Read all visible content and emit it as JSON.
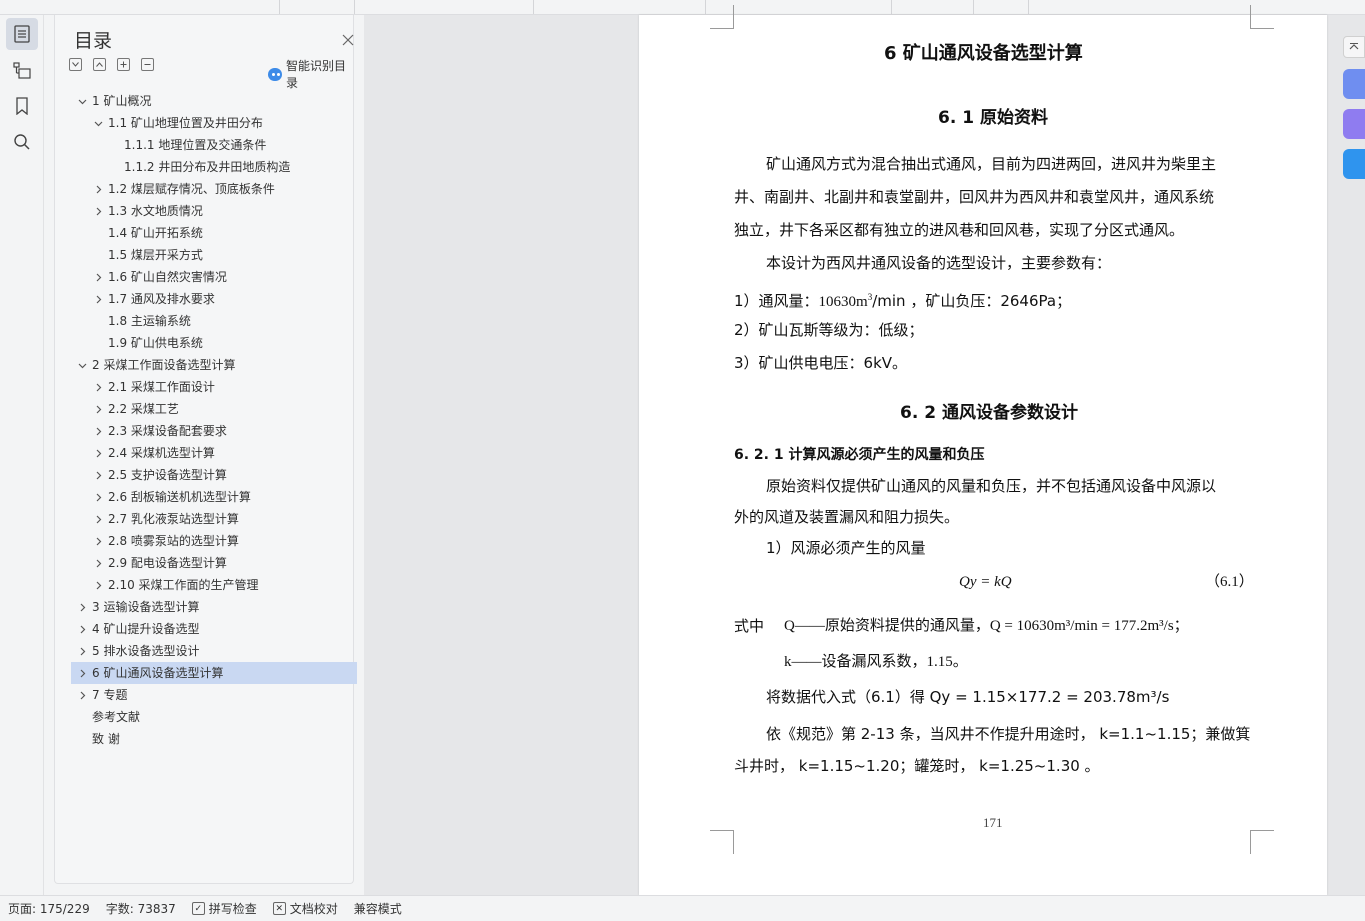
{
  "toc": {
    "title": "目录",
    "smart_label": "智能识别目录",
    "items": [
      {
        "label": "1 矿山概况",
        "level": 0,
        "chevron": "down"
      },
      {
        "label": "1.1 矿山地理位置及井田分布",
        "level": 1,
        "chevron": "down"
      },
      {
        "label": "1.1.1 地理位置及交通条件",
        "level": 2,
        "chevron": "none"
      },
      {
        "label": "1.1.2 井田分布及井田地质构造",
        "level": 2,
        "chevron": "none"
      },
      {
        "label": "1.2 煤层赋存情况、顶底板条件",
        "level": 1,
        "chevron": "right"
      },
      {
        "label": "1.3 水文地质情况",
        "level": 1,
        "chevron": "right"
      },
      {
        "label": "1.4 矿山开拓系统",
        "level": 1,
        "chevron": "none"
      },
      {
        "label": "1.5 煤层开采方式",
        "level": 1,
        "chevron": "none"
      },
      {
        "label": "1.6 矿山自然灾害情况",
        "level": 1,
        "chevron": "right"
      },
      {
        "label": "1.7 通风及排水要求",
        "level": 1,
        "chevron": "right"
      },
      {
        "label": "1.8 主运输系统",
        "level": 1,
        "chevron": "none"
      },
      {
        "label": "1.9 矿山供电系统",
        "level": 1,
        "chevron": "none"
      },
      {
        "label": "2 采煤工作面设备选型计算",
        "level": 0,
        "chevron": "down"
      },
      {
        "label": "2.1 采煤工作面设计",
        "level": 1,
        "chevron": "right"
      },
      {
        "label": "2.2  采煤工艺",
        "level": 1,
        "chevron": "right"
      },
      {
        "label": "2.3 采煤设备配套要求",
        "level": 1,
        "chevron": "right"
      },
      {
        "label": "2.4  采煤机选型计算",
        "level": 1,
        "chevron": "right"
      },
      {
        "label": "2.5 支护设备选型计算",
        "level": 1,
        "chevron": "right"
      },
      {
        "label": "2.6 刮板输送机机选型计算",
        "level": 1,
        "chevron": "right"
      },
      {
        "label": "2.7  乳化液泵站选型计算",
        "level": 1,
        "chevron": "right"
      },
      {
        "label": "2.8 喷雾泵站的选型计算",
        "level": 1,
        "chevron": "right"
      },
      {
        "label": "2.9  配电设备选型计算",
        "level": 1,
        "chevron": "right"
      },
      {
        "label": "2.10 采煤工作面的生产管理",
        "level": 1,
        "chevron": "right"
      },
      {
        "label": "3 运输设备选型计算",
        "level": 0,
        "chevron": "right"
      },
      {
        "label": "4 矿山提升设备选型",
        "level": 0,
        "chevron": "right"
      },
      {
        "label": "5 排水设备选型设计",
        "level": 0,
        "chevron": "right"
      },
      {
        "label": "6 矿山通风设备选型计算",
        "level": 0,
        "chevron": "right",
        "selected": true
      },
      {
        "label": "7 专题",
        "level": 0,
        "chevron": "right"
      },
      {
        "label": "参考文献",
        "level": 0,
        "chevron": "none"
      },
      {
        "label": "致    谢",
        "level": 0,
        "chevron": "none"
      }
    ]
  },
  "doc": {
    "chapter_title": "6 矿山通风设备选型计算",
    "sec1_title": "6. 1 原始资料",
    "para1_line1": "矿山通风方式为混合抽出式通风，目前为四进两回，进风井为柴里主",
    "para1_line2": "井、南副井、北副井和袁堂副井，回风井为西风井和袁堂风井，通风系统",
    "para1_line3": "独立，井下各采区都有独立的进风巷和回风巷，实现了分区式通风。",
    "para2": "本设计为西风井通风设备的选型设计，主要参数有：",
    "item1_a": "1）通风量：",
    "item1_b": "10630m",
    "item1_sup": "3",
    "item1_c": "/min ，矿山负压：2646Pa；",
    "item2": "2）矿山瓦斯等级为：低级；",
    "item3": "3）矿山供电电压：6kV。",
    "sec2_title": "6. 2 通风设备参数设计",
    "sub1_title": "6. 2. 1 计算风源必须产生的风量和负压",
    "para3_line1": "原始资料仅提供矿山通风的风量和负压，并不包括通风设备中风源以",
    "para3_line2": "外的风道及装置漏风和阻力损失。",
    "item4": "1）风源必须产生的风量",
    "formula": "Qy = kQ",
    "formula_no": "（6.1）",
    "where_label": "式中",
    "where_q": "Q——原始资料提供的通风量，Q = 10630m³/min = 177.2m³/s；",
    "where_k": "k——设备漏风系数，1.15。",
    "subst": "将数据代入式（6.1）得 Qy = 1.15×177.2 = 203.78m³/s",
    "para4_line1": "依《规范》第 2-13 条，当风井不作提升用途时， k=1.1~1.15；兼做箕",
    "para4_line2": "斗井时， k=1.15~1.20；罐笼时， k=1.25~1.30 。",
    "page_number": "171"
  },
  "status": {
    "page": "页面: 175/229",
    "words": "字数: 73837",
    "spell": "拼写检查",
    "proof": "文档校对",
    "compat": "兼容模式"
  }
}
